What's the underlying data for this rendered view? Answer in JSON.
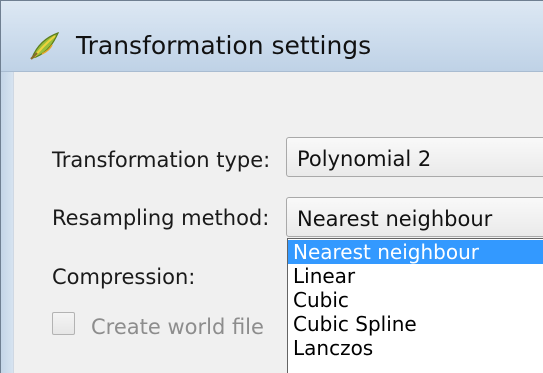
{
  "window": {
    "title": "Transformation settings",
    "icon": "qgis-leaf-icon"
  },
  "form": {
    "transformation_type_label": "Transformation type:",
    "transformation_type_value": "Polynomial 2",
    "resampling_method_label": "Resampling method:",
    "resampling_method_value": "Nearest neighbour",
    "compression_label": "Compression:",
    "create_world_file_label": "Create world file",
    "create_world_file_checked": false
  },
  "resampling_dropdown": {
    "options": [
      "Nearest neighbour",
      "Linear",
      "Cubic",
      "Cubic Spline",
      "Lanczos"
    ],
    "selected": "Nearest neighbour"
  },
  "colors": {
    "selection": "#3399ff",
    "titlebar": "#cfdeee",
    "dialog_bg": "#f0f0f0"
  }
}
